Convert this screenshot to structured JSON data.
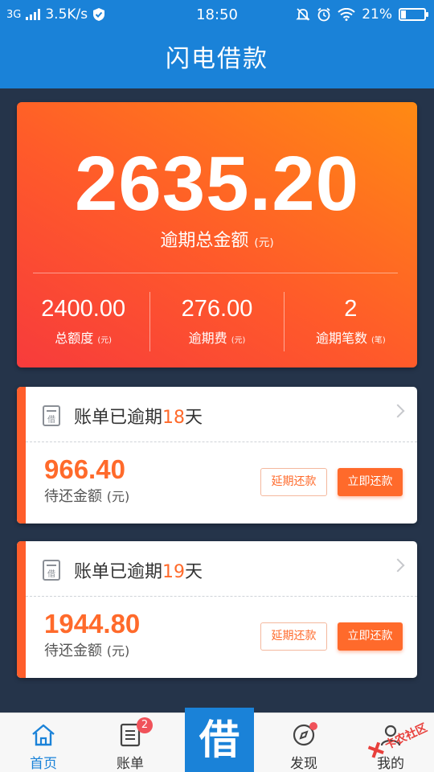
{
  "status_bar": {
    "network": "3G",
    "speed": "3.5K/s",
    "time": "18:50",
    "battery": "21%",
    "battery_level": 0.21
  },
  "nav": {
    "title": "闪电借款"
  },
  "summary": {
    "total_overdue_amount": "2635.20",
    "total_overdue_label": "逾期总金额",
    "unit": "(元)",
    "stats": [
      {
        "value": "2400.00",
        "label": "总额度",
        "unit": "(元)"
      },
      {
        "value": "276.00",
        "label": "逾期费",
        "unit": "(元)"
      },
      {
        "value": "2",
        "label": "逾期笔数",
        "unit": "(笔)"
      }
    ]
  },
  "bills": [
    {
      "prefix": "账单已逾期",
      "days": "18",
      "suffix": "天",
      "amount": "966.40",
      "amount_label": "待还金额",
      "unit": "(元)",
      "extend_label": "延期还款",
      "pay_label": "立即还款"
    },
    {
      "prefix": "账单已逾期",
      "days": "19",
      "suffix": "天",
      "amount": "1944.80",
      "amount_label": "待还金额",
      "unit": "(元)",
      "extend_label": "延期还款",
      "pay_label": "立即还款"
    }
  ],
  "tabbar": {
    "home": "首页",
    "bills": "账单",
    "bills_badge": "2",
    "borrow": "借",
    "discover": "发现",
    "mine": "我的",
    "watermark": "卡农社区"
  },
  "colors": {
    "primary": "#1a82d8",
    "accent": "#ff6a2b",
    "background": "#25344a"
  }
}
